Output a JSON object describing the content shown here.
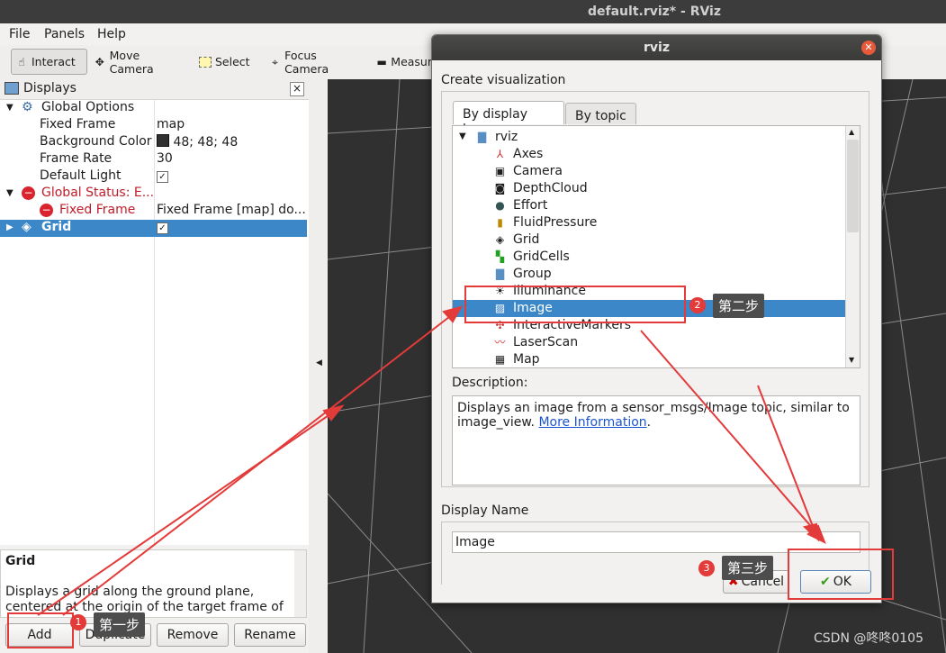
{
  "window_title": "default.rviz* - RViz",
  "menu": {
    "file": "File",
    "panels": "Panels",
    "help": "Help"
  },
  "toolbar": {
    "interact": "Interact",
    "move_camera": "Move Camera",
    "select": "Select",
    "focus_camera": "Focus Camera",
    "measure": "Measur"
  },
  "displays": {
    "title": "Displays",
    "close": "×",
    "rows": [
      {
        "key": "Global Options",
        "value": ""
      },
      {
        "key": "Fixed Frame",
        "value": "map"
      },
      {
        "key": "Background Color",
        "value": "48; 48; 48"
      },
      {
        "key": "Frame Rate",
        "value": "30"
      },
      {
        "key": "Default Light",
        "value": "✓"
      },
      {
        "key": "Global Status: E...",
        "value": ""
      },
      {
        "key": "Fixed Frame",
        "value": "Fixed Frame [map] do..."
      },
      {
        "key": "Grid",
        "value": "✓"
      }
    ],
    "background_color_hex": "#303030"
  },
  "description_panel": {
    "title": "Grid",
    "line1": "Displays a grid along the ground plane,",
    "line2": "centered at the origin of the target frame of"
  },
  "bottom_buttons": {
    "add": "Add",
    "duplicate": "Duplicate",
    "remove": "Remove",
    "rename": "Rename"
  },
  "dialog": {
    "title": "rviz",
    "create_label": "Create visualization",
    "tabs": {
      "by_display_type": "By display type",
      "by_topic": "By topic"
    },
    "root": "rviz",
    "items": [
      "Axes",
      "Camera",
      "DepthCloud",
      "Effort",
      "FluidPressure",
      "Grid",
      "GridCells",
      "Group",
      "Illuminance",
      "Image",
      "InteractiveMarkers",
      "LaserScan",
      "Map"
    ],
    "selected_item": "Image",
    "description_label": "Description:",
    "description_text": "Displays an image from a sensor_msgs/Image topic, similar to",
    "description_text2": "image_view.",
    "more_info": "More Information",
    "period": ".",
    "display_name_label": "Display Name",
    "display_name_value": "Image",
    "cancel": "Cancel",
    "ok": "OK"
  },
  "annotations": {
    "step1_num": "1",
    "step1": "第一步",
    "step2_num": "2",
    "step2": "第二步",
    "step3_num": "3",
    "step3": "第三步",
    "accent": "#e33a3a"
  },
  "watermark": "CSDN @咚咚0105"
}
